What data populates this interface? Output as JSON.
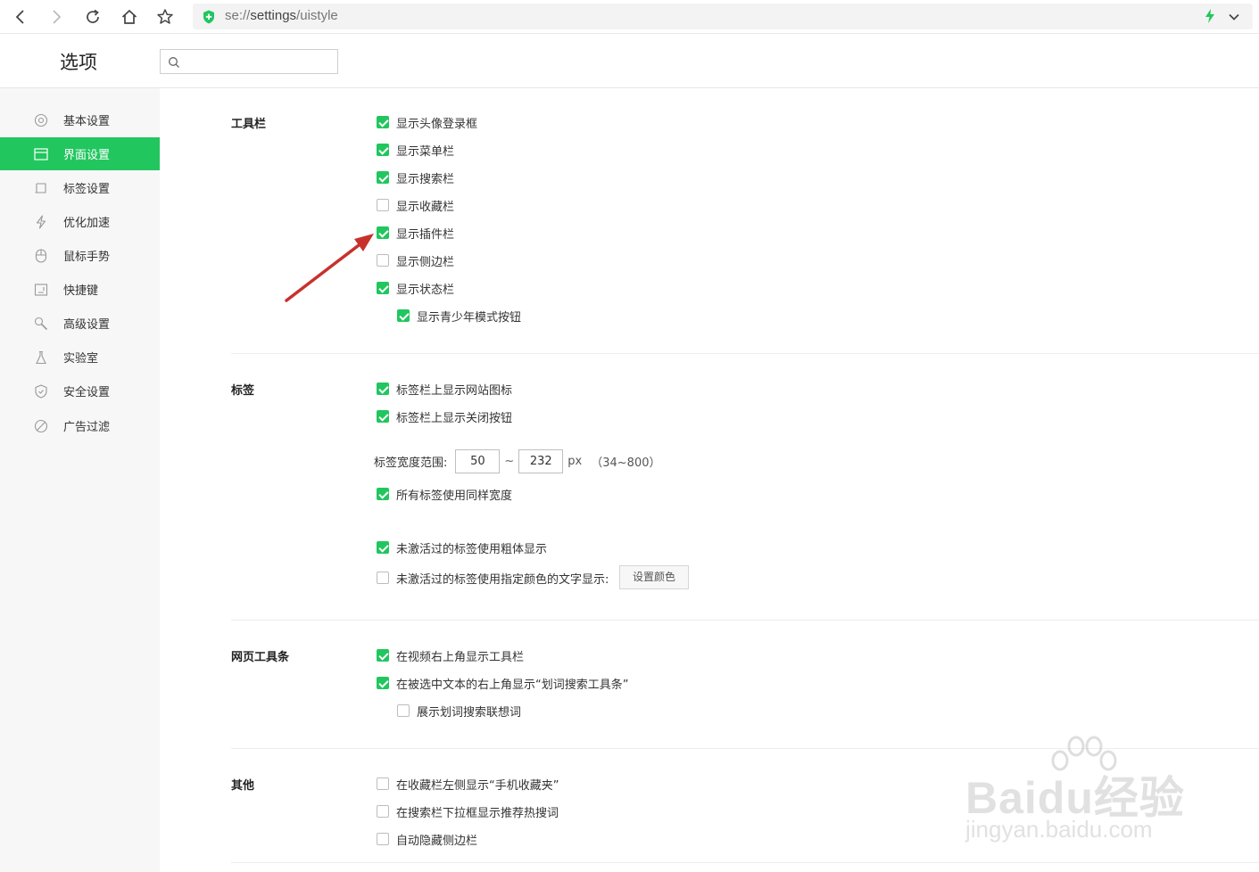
{
  "browser": {
    "url_scheme": "se://",
    "url_path": "settings",
    "url_rest": "/uistyle",
    "accent": "#21c65f"
  },
  "header": {
    "title": "选项",
    "search_placeholder": ""
  },
  "sidebar": {
    "items": [
      {
        "label": "基本设置",
        "icon": "gear-icon",
        "active": false
      },
      {
        "label": "界面设置",
        "icon": "window-icon",
        "active": true
      },
      {
        "label": "标签设置",
        "icon": "tab-icon",
        "active": false
      },
      {
        "label": "优化加速",
        "icon": "bolt-icon",
        "active": false
      },
      {
        "label": "鼠标手势",
        "icon": "mouse-icon",
        "active": false
      },
      {
        "label": "快捷键",
        "icon": "keyboard-icon",
        "active": false
      },
      {
        "label": "高级设置",
        "icon": "wrench-icon",
        "active": false
      },
      {
        "label": "实验室",
        "icon": "flask-icon",
        "active": false
      },
      {
        "label": "安全设置",
        "icon": "shield-icon",
        "active": false
      },
      {
        "label": "广告过滤",
        "icon": "block-icon",
        "active": false
      }
    ]
  },
  "sections": {
    "toolbar": {
      "title": "工具栏",
      "options": [
        {
          "label": "显示头像登录框",
          "checked": true
        },
        {
          "label": "显示菜单栏",
          "checked": true
        },
        {
          "label": "显示搜索栏",
          "checked": true
        },
        {
          "label": "显示收藏栏",
          "checked": false
        },
        {
          "label": "显示插件栏",
          "checked": true
        },
        {
          "label": "显示侧边栏",
          "checked": false
        },
        {
          "label": "显示状态栏",
          "checked": true
        },
        {
          "label": "显示青少年模式按钮",
          "checked": true
        }
      ]
    },
    "tabs": {
      "title": "标签",
      "options": [
        {
          "label": "标签栏上显示网站图标",
          "checked": true
        },
        {
          "label": "标签栏上显示关闭按钮",
          "checked": true
        },
        {
          "label": "所有标签使用同样宽度",
          "checked": true
        },
        {
          "label": "未激活过的标签使用粗体显示",
          "checked": true
        },
        {
          "label": "未激活过的标签使用指定颜色的文字显示:",
          "checked": false
        }
      ],
      "width_label": "标签宽度范围:",
      "width_min": "50",
      "width_sep": "~",
      "width_max": "232",
      "width_unit": "px",
      "width_hint": "（34~800）",
      "set_color_button": "设置颜色"
    },
    "webbar": {
      "title": "网页工具条",
      "options": [
        {
          "label": "在视频右上角显示工具栏",
          "checked": true
        },
        {
          "label": "在被选中文本的右上角显示“划词搜索工具条”",
          "checked": true
        },
        {
          "label": "展示划词搜索联想词",
          "checked": false
        }
      ]
    },
    "other": {
      "title": "其他",
      "options": [
        {
          "label": "在收藏栏左侧显示“手机收藏夹”",
          "checked": false
        },
        {
          "label": "在搜索栏下拉框显示推荐热搜词",
          "checked": false
        },
        {
          "label": "自动隐藏侧边栏",
          "checked": false
        }
      ]
    }
  },
  "watermark": {
    "brand": "Baidu经验",
    "sub": "jingyan.baidu.com"
  }
}
